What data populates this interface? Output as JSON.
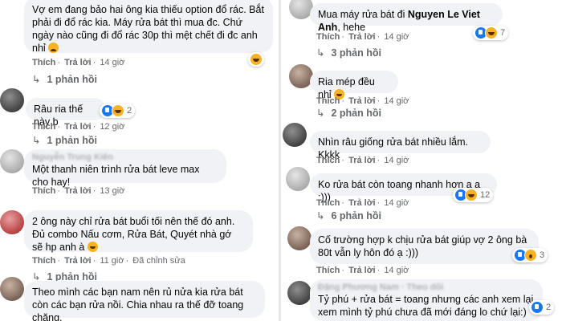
{
  "left": [
    {
      "text": "Vợ em đang bảo hai ông kia thiếu option đổ rác. Bắt phải đi đổ rác kia. Máy rửa bát thì mua đc. Chứ ngày nào cũng đi đổ rác 30p thì mệt chết đi đc anh nhỉ",
      "like": "Thích",
      "reply": "Trả lời",
      "time": "14 giờ",
      "replies": "1 phản hồi",
      "emoji": "sad"
    },
    {
      "text": "Râu ria thế này b",
      "like": "Thích",
      "reply": "Trả lời",
      "time": "12 giờ",
      "replies": "1 phản hồi",
      "reaction_count": "2"
    },
    {
      "name": "Nguyễn Trung Kiên",
      "text": "Một thanh niên trình rửa bát leve max cho hay!",
      "like": "Thích",
      "reply": "Trả lời",
      "time": "13 giờ"
    },
    {
      "text": "2 ông này chỉ rửa bát buổi tối nên thế đó anh. Đủ combo Nấu cơm, Rửa Bát, Quyét nhà gớ sẽ hp anh à",
      "like": "Thích",
      "reply": "Trả lời",
      "time": "11 giờ",
      "edited": "Đã chỉnh sửa",
      "replies": "1 phản hồi",
      "emoji": "haha"
    },
    {
      "text": "Theo mình các bạn nam nên rủ nửa kia rửa bát còn các bạn rửa nồi. Chia nhau ra thế đỡ toang chăng."
    }
  ],
  "right": [
    {
      "text_before": "Mua máy rửa bát đi ",
      "mention": "Nguyen Le Viet Anh",
      "text_after": ", hehe",
      "like": "Thích",
      "reply": "Trả lời",
      "time": "14 giờ",
      "replies": "3 phản hồi",
      "reaction_count": "7"
    },
    {
      "text": "Ria mép đều nhỉ",
      "like": "Thích",
      "reply": "Trả lời",
      "time": "14 giờ",
      "replies": "2 phản hồi",
      "emoji": "haha"
    },
    {
      "text": "Nhìn râu giống rửa bát nhiều lắm. Kkkk",
      "like": "Thích",
      "reply": "Trả lời",
      "time": "14 giờ"
    },
    {
      "text": "Ko rửa bát còn toang nhanh hơn a ạ :)))",
      "like": "Thích",
      "reply": "Trả lời",
      "time": "14 giờ",
      "replies": "6 phản hồi",
      "reaction_count": "12"
    },
    {
      "text": "Cố trường hợp k chịu rửa bát giúp vợ 2 ông bà 80t vẫn ly hôn đó ạ :)))",
      "like": "Thích",
      "reply": "Trả lời",
      "time": "14 giờ",
      "reaction_count": "3"
    },
    {
      "name": "Đặng Phương Nam · Theo dõi",
      "text": "Tỷ phú + rửa bát = toang nhưng các anh xem lại xem mình tỷ phú chưa đã mới đáng lo chứ lại:)",
      "reaction_count": "2"
    }
  ]
}
